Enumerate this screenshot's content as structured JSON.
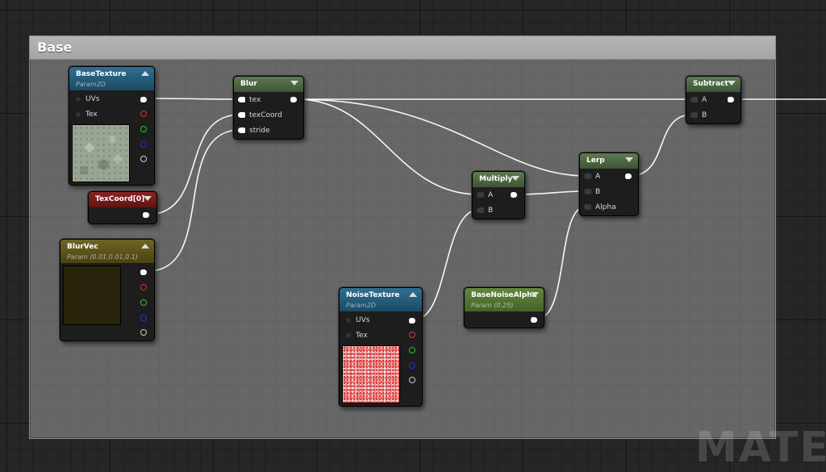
{
  "comment": {
    "title": "Base"
  },
  "watermark": "MATER",
  "colors": {
    "background": "#262626",
    "wire": "#ffffff",
    "texture_header": "#2f6f93",
    "math_header": "#5d7a52",
    "texcoord_header": "#8b2323",
    "vector_param_header": "#6e6523",
    "scalar_param_header": "#64863e"
  },
  "nodes": {
    "base_texture": {
      "title": "BaseTexture",
      "subtitle": "Param2D",
      "inputs": [
        "UVs",
        "Tex"
      ]
    },
    "texcoord": {
      "title": "TexCoord[0]"
    },
    "blur_vec": {
      "title": "BlurVec",
      "subtitle": "Param (0.01,0.01,0.1)"
    },
    "blur": {
      "title": "Blur",
      "inputs": [
        "tex",
        "texCoord",
        "stride"
      ]
    },
    "multiply": {
      "title": "Multiply",
      "inputs": [
        "A",
        "B"
      ]
    },
    "lerp": {
      "title": "Lerp",
      "inputs": [
        "A",
        "B",
        "Alpha"
      ]
    },
    "subtract": {
      "title": "Subtract",
      "inputs": [
        "A",
        "B"
      ]
    },
    "noise_texture": {
      "title": "NoiseTexture",
      "subtitle": "Param2D",
      "inputs": [
        "UVs",
        "Tex"
      ]
    },
    "base_noise_alpha": {
      "title": "BaseNoiseAlpha",
      "subtitle": "Param (0.25)"
    }
  },
  "icons": {
    "collapse": "collapse-arrow-icon",
    "pin": "pin-icon"
  }
}
